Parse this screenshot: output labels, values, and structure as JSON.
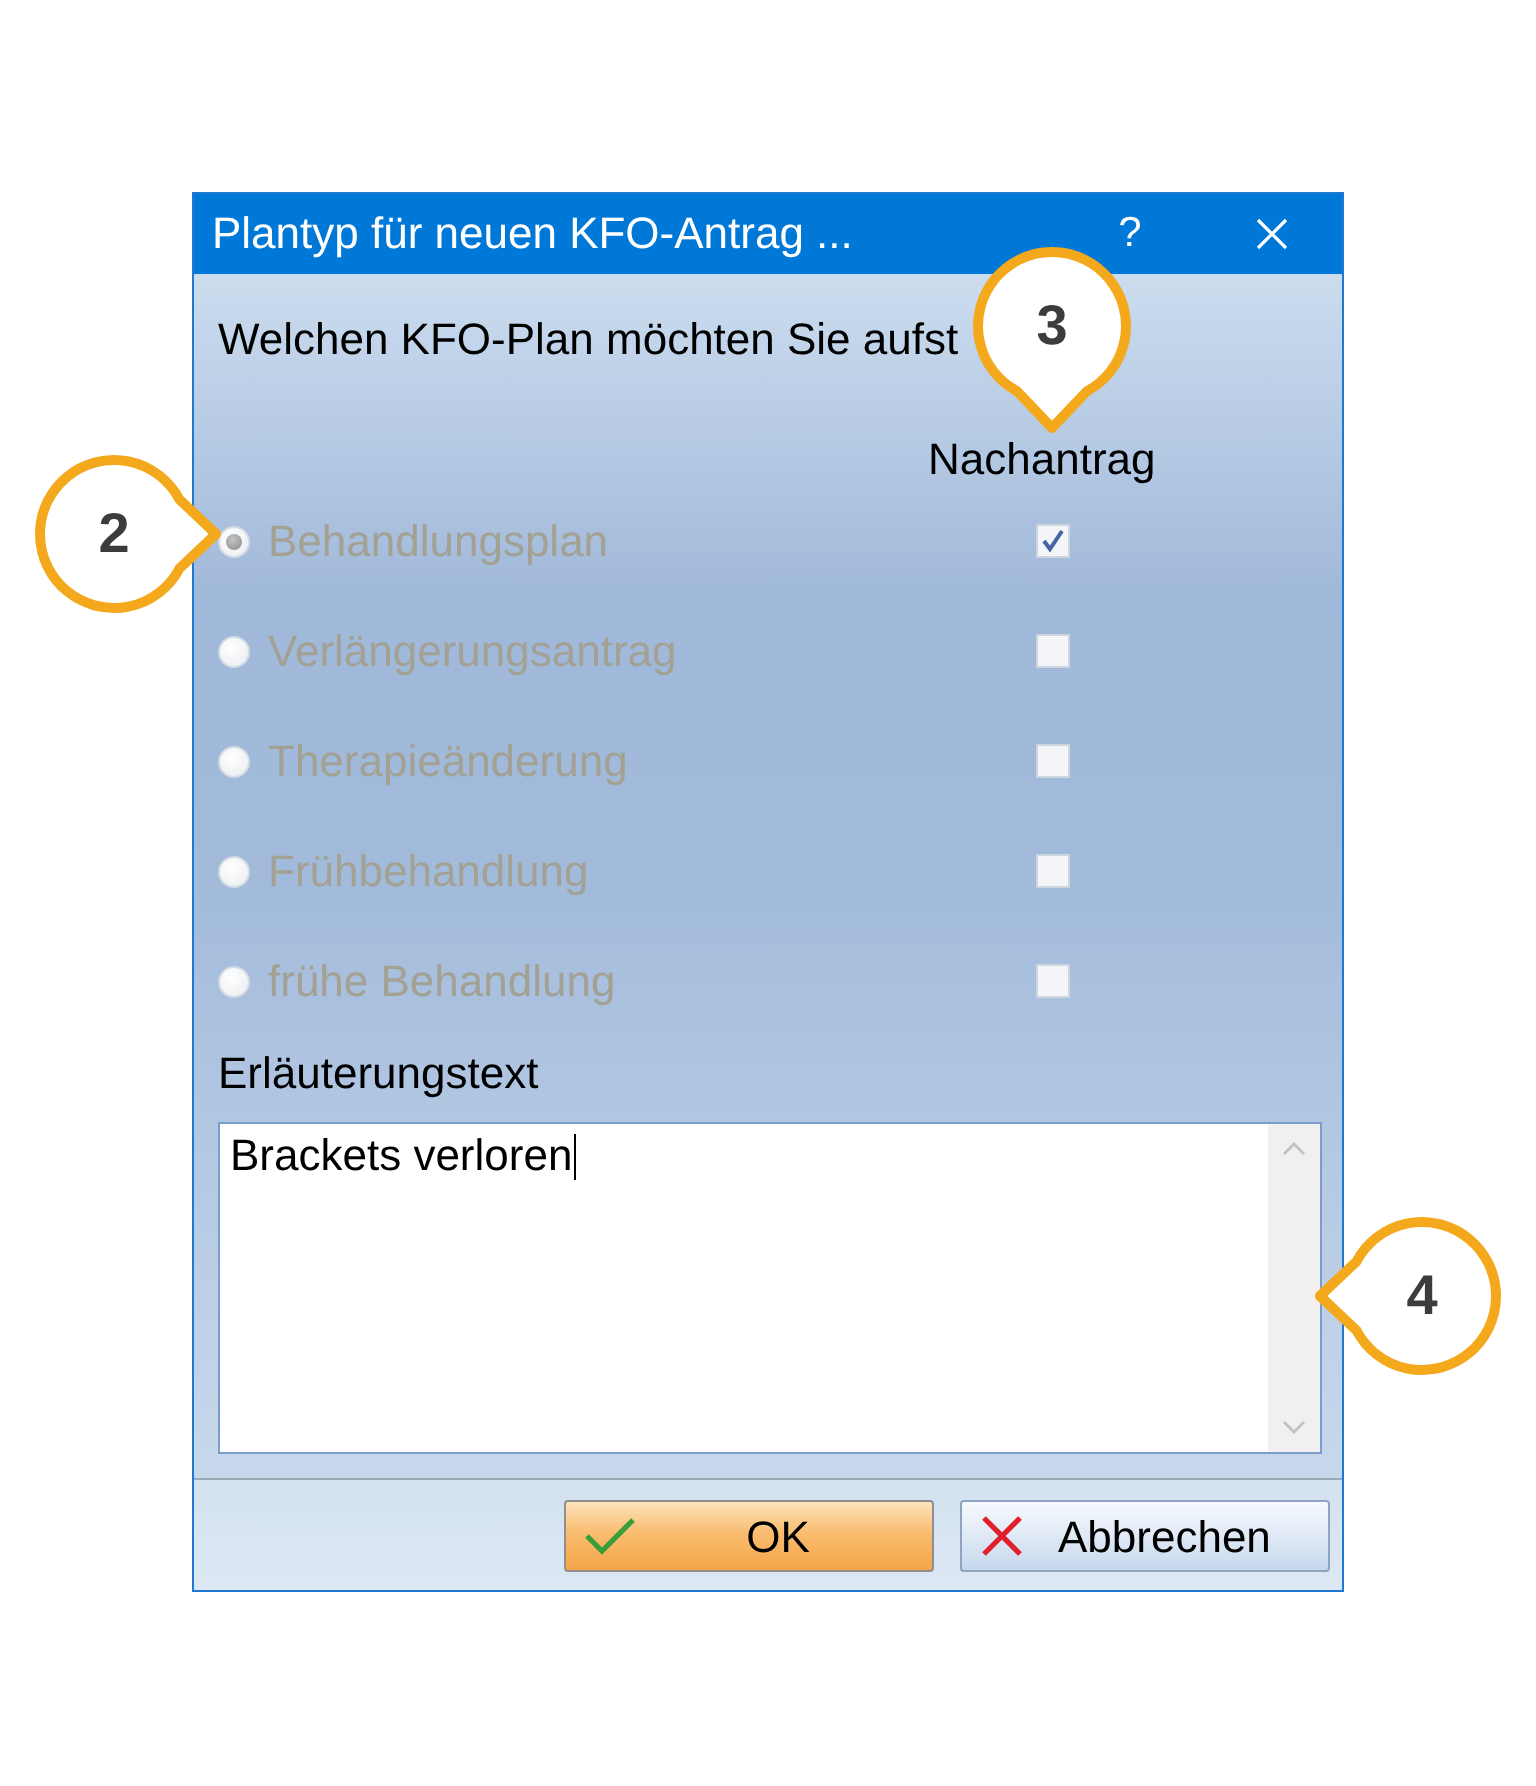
{
  "window": {
    "title": "Plantyp für neuen KFO-Antrag ...",
    "help_button": "?"
  },
  "question": "Welchen KFO-Plan möchten Sie aufst",
  "column_header": "Nachantrag",
  "plan_options": [
    {
      "label": "Behandlungsplan",
      "selected": true,
      "checked": true,
      "disabled": true
    },
    {
      "label": "Verlängerungsantrag",
      "selected": false,
      "checked": false,
      "disabled": true
    },
    {
      "label": "Therapieänderung",
      "selected": false,
      "checked": false,
      "disabled": true
    },
    {
      "label": "Frühbehandlung",
      "selected": false,
      "checked": false,
      "disabled": true
    },
    {
      "label": "frühe Behandlung",
      "selected": false,
      "checked": false,
      "disabled": true
    }
  ],
  "explanation": {
    "label": "Erläuterungstext",
    "value": "Brackets verloren"
  },
  "buttons": [
    {
      "label": "OK",
      "kind": "confirm"
    },
    {
      "label": "Abbrechen",
      "kind": "cancel"
    }
  ],
  "callouts": [
    {
      "label": "2"
    },
    {
      "label": "3"
    },
    {
      "label": "4"
    }
  ]
}
